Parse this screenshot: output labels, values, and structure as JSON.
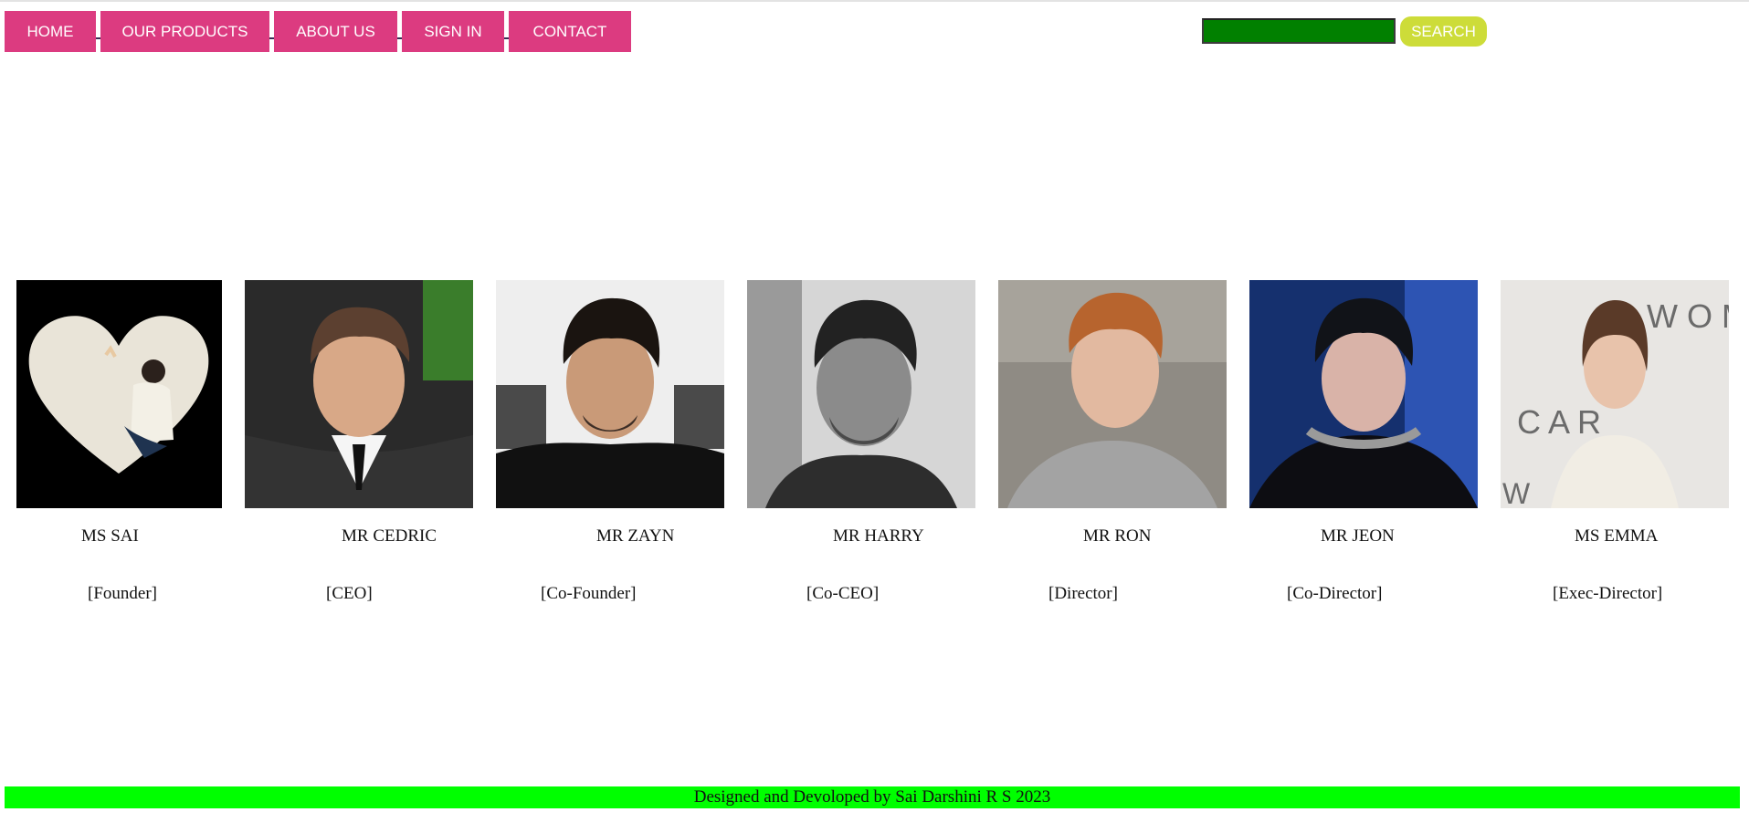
{
  "nav": {
    "items": [
      {
        "label": "HOME"
      },
      {
        "label": "OUR PRODUCTS"
      },
      {
        "label": "ABOUT US"
      },
      {
        "label": "SIGN IN"
      },
      {
        "label": "CONTACT"
      }
    ]
  },
  "search": {
    "value": "",
    "button_label": "SEARCH"
  },
  "team": [
    {
      "name": "MS SAI",
      "role": "[Founder]",
      "photo": "heart-portrait"
    },
    {
      "name": "MR CEDRIC",
      "role": "[CEO]",
      "photo": "portrait"
    },
    {
      "name": "MR ZAYN",
      "role": "[Co-Founder]",
      "photo": "portrait"
    },
    {
      "name": "MR HARRY",
      "role": "[Co-CEO]",
      "photo": "portrait"
    },
    {
      "name": "MR RON",
      "role": "[Director]",
      "photo": "portrait"
    },
    {
      "name": "MR JEON",
      "role": "[Co-Director]",
      "photo": "portrait"
    },
    {
      "name": "MS EMMA",
      "role": "[Exec-Director]",
      "photo": "portrait"
    }
  ],
  "footer": {
    "text": "Designed and Devoloped by Sai Darshini R S 2023"
  },
  "colors": {
    "nav": "#dc3b80",
    "search_field": "#018000",
    "search_button": "#cddc39",
    "footer": "#00ff00"
  }
}
